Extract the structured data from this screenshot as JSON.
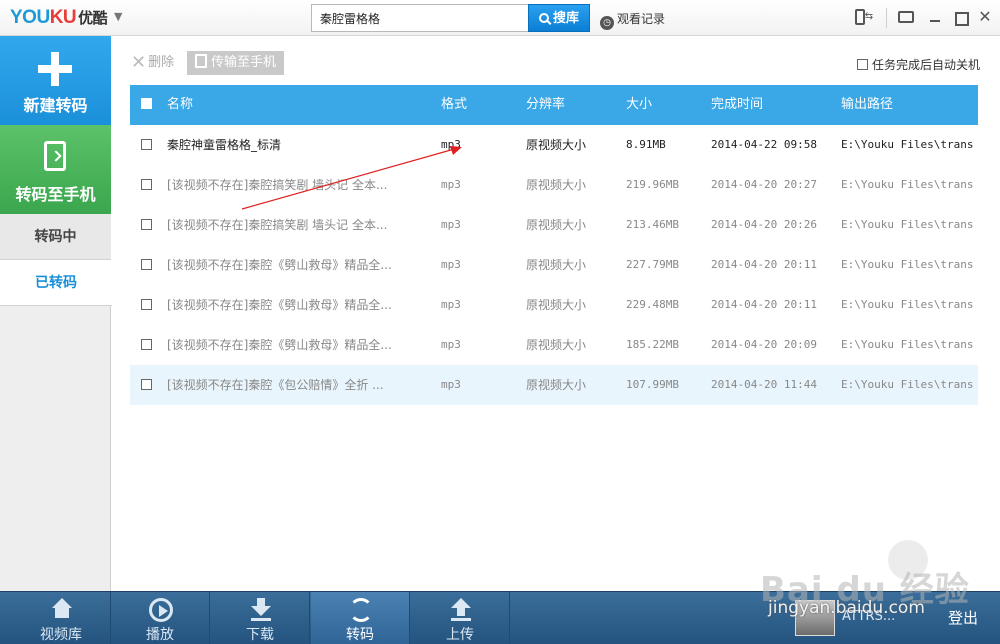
{
  "app": {
    "logo_you": "YOU",
    "logo_ku": "KU",
    "logo_cn": "优酷",
    "menu_arrow": "▼"
  },
  "search": {
    "value": "秦腔雷格格",
    "button_label": "搜库"
  },
  "history_label": "观看记录",
  "window": {
    "close": "✕"
  },
  "sidebar": {
    "new_label": "新建转码",
    "to_phone_label": "转码至手机",
    "converting_label": "转码中",
    "converted_label": "已转码"
  },
  "toolbar": {
    "delete_label": "删除",
    "transfer_label": "传输至手机",
    "auto_shutdown_label": "任务完成后自动关机"
  },
  "table": {
    "headers": {
      "name": "名称",
      "format": "格式",
      "resolution": "分辨率",
      "size": "大小",
      "finish_time": "完成时间",
      "output_path": "输出路径"
    },
    "rows": [
      {
        "name": "秦腔神童雷格格_标清",
        "format": "mp3",
        "resolution": "原视频大小",
        "size": "8.91MB",
        "time": "2014-04-22 09:58",
        "path": "E:\\Youku Files\\trans"
      },
      {
        "name": "[该视频不存在]秦腔搞笑剧 墙头记 全本...",
        "format": "mp3",
        "resolution": "原视频大小",
        "size": "219.96MB",
        "time": "2014-04-20 20:27",
        "path": "E:\\Youku Files\\trans"
      },
      {
        "name": "[该视频不存在]秦腔搞笑剧 墙头记 全本...",
        "format": "mp3",
        "resolution": "原视频大小",
        "size": "213.46MB",
        "time": "2014-04-20 20:26",
        "path": "E:\\Youku Files\\trans"
      },
      {
        "name": "[该视频不存在]秦腔《劈山救母》精品全...",
        "format": "mp3",
        "resolution": "原视频大小",
        "size": "227.79MB",
        "time": "2014-04-20 20:11",
        "path": "E:\\Youku Files\\trans"
      },
      {
        "name": "[该视频不存在]秦腔《劈山救母》精品全...",
        "format": "mp3",
        "resolution": "原视频大小",
        "size": "229.48MB",
        "time": "2014-04-20 20:11",
        "path": "E:\\Youku Files\\trans"
      },
      {
        "name": "[该视频不存在]秦腔《劈山救母》精品全...",
        "format": "mp3",
        "resolution": "原视频大小",
        "size": "185.22MB",
        "time": "2014-04-20 20:09",
        "path": "E:\\Youku Files\\trans"
      },
      {
        "name": "[该视频不存在]秦腔《包公赔情》全折 ...",
        "format": "mp3",
        "resolution": "原视频大小",
        "size": "107.99MB",
        "time": "2014-04-20 11:44",
        "path": "E:\\Youku Files\\trans"
      }
    ]
  },
  "bottom_nav": {
    "library": "视频库",
    "play": "播放",
    "download": "下载",
    "convert": "转码",
    "upload": "上传"
  },
  "user": {
    "name": "ATTRS...",
    "logout": "登出"
  },
  "watermark": {
    "main": "Bai du 经验",
    "url": "jingyan.baidu.com"
  },
  "colors": {
    "accent_blue": "#3aa7e6",
    "sidebar_green": "#3aa64d",
    "annotation_arrow": "#e02020"
  }
}
